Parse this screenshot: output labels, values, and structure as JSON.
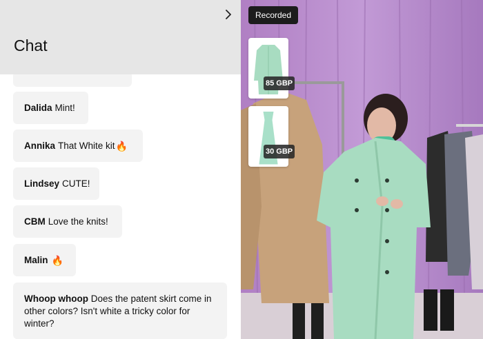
{
  "chat": {
    "title": "Chat",
    "messages": [
      {
        "author": "Dalida",
        "text": "Mint!"
      },
      {
        "author": "Annika",
        "text": "That White kit",
        "emoji": "🔥"
      },
      {
        "author": "Lindsey",
        "text": "CUTE!"
      },
      {
        "author": "CBM",
        "text": "Love the knits!"
      },
      {
        "author": "Malin",
        "text": "",
        "emoji": "🔥"
      },
      {
        "author": "Whoop whoop",
        "text": "Does the patent skirt come in other colors? Isn't white a tricky color for winter?"
      }
    ]
  },
  "video": {
    "status_badge": "Recorded",
    "products": [
      {
        "name": "mint-coat",
        "price": "85 GBP",
        "color": "#a8dcc1"
      },
      {
        "name": "mint-slip-dress",
        "price": "30 GBP",
        "color": "#a9e0c9"
      }
    ]
  },
  "colors": {
    "header_bg": "#e6e6e6",
    "bubble_bg": "#f3f3f3",
    "backdrop": "#b88dcc",
    "mint": "#a8dcc1"
  }
}
